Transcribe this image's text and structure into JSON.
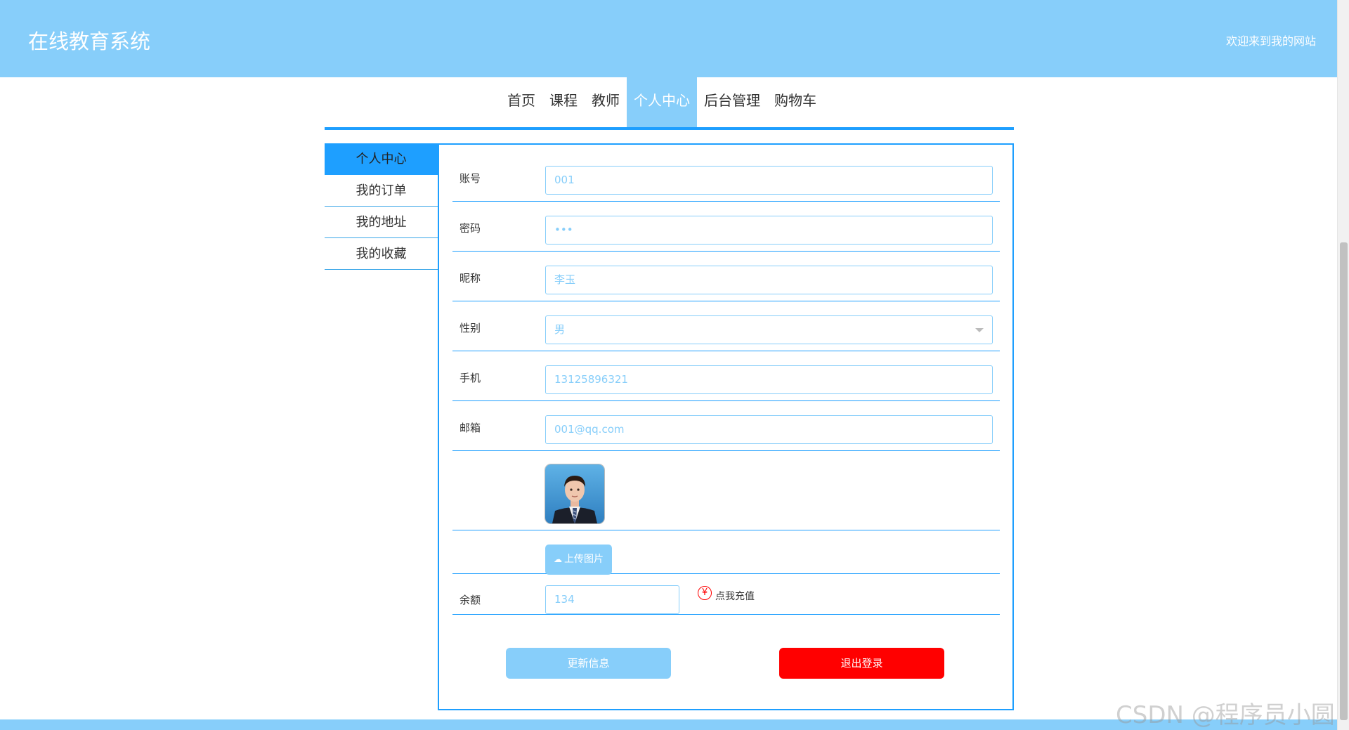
{
  "header": {
    "site_title": "在线教育系统",
    "welcome": "欢迎来到我的网站"
  },
  "nav": {
    "items": [
      {
        "label": "首页",
        "active": false
      },
      {
        "label": "课程",
        "active": false
      },
      {
        "label": "教师",
        "active": false
      },
      {
        "label": "个人中心",
        "active": true
      },
      {
        "label": "后台管理",
        "active": false
      },
      {
        "label": "购物车",
        "active": false
      }
    ]
  },
  "sidemenu": {
    "items": [
      {
        "label": "个人中心",
        "active": true
      },
      {
        "label": "我的订单",
        "active": false
      },
      {
        "label": "我的地址",
        "active": false
      },
      {
        "label": "我的收藏",
        "active": false
      }
    ]
  },
  "form": {
    "account": {
      "label": "账号",
      "value": "001"
    },
    "password": {
      "label": "密码",
      "value": "•••"
    },
    "nickname": {
      "label": "昵称",
      "value": "李玉"
    },
    "gender": {
      "label": "性别",
      "value": "男"
    },
    "phone": {
      "label": "手机",
      "value": "13125896321"
    },
    "email": {
      "label": "邮箱",
      "value": "001@qq.com"
    },
    "upload_label": "上传图片",
    "balance": {
      "label": "余额",
      "value": "134"
    },
    "recharge_label": "点我充值",
    "yen_symbol": "¥",
    "update_button": "更新信息",
    "logout_button": "退出登录"
  },
  "watermark": "CSDN @程序员小圆",
  "colors": {
    "header_bg": "#87CEFA",
    "accent": "#1E9FFF",
    "danger": "#FF0000"
  }
}
